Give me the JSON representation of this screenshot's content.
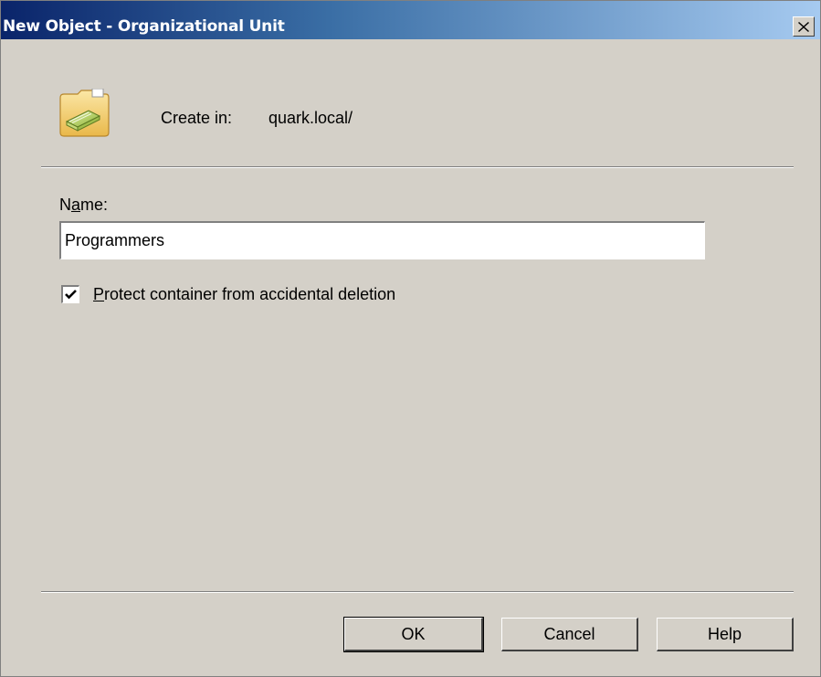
{
  "window": {
    "title": "New Object - Organizational Unit",
    "close_glyph": "close-icon"
  },
  "header": {
    "icon": "organizational-unit-folder-icon",
    "create_in_label": "Create in:",
    "create_in_value": "quark.local/"
  },
  "form": {
    "name_label_prefix": "N",
    "name_label_accel": "a",
    "name_label_suffix": "me:",
    "name_value": "Programmers",
    "protect_checked": true,
    "protect_label_accel": "P",
    "protect_label_rest": "rotect container from accidental deletion"
  },
  "buttons": {
    "ok": "OK",
    "cancel": "Cancel",
    "help": "Help"
  },
  "colors": {
    "dialog_bg": "#d4d0c8",
    "titlebar_start": "#0a246a",
    "titlebar_end": "#a6caf0"
  }
}
